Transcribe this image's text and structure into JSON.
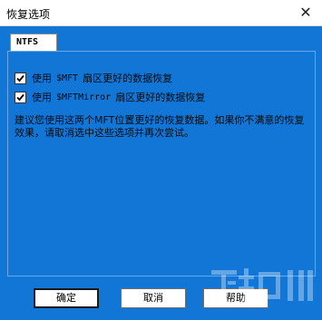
{
  "window": {
    "title": "恢复选项",
    "close_glyph": "✕"
  },
  "tabs": [
    {
      "label": "NTFS"
    }
  ],
  "options": [
    {
      "prefix": "使用",
      "code": "$MFT",
      "suffix": "扇区更好的数据恢复",
      "checked": true
    },
    {
      "prefix": "使用",
      "code": "$MFTMirror",
      "suffix": "扇区更好的数据恢复",
      "checked": true
    }
  ],
  "description": "建议您使用这两个MFT位置更好的恢复数据。如果你不满意的恢复效果，请取消选中这些选项并再次尝试。",
  "buttons": {
    "ok": "确定",
    "cancel": "取消",
    "help": "帮助"
  },
  "icons": {
    "close": "close-icon",
    "check": "checkmark-icon"
  },
  "colors": {
    "background": "#1176d6",
    "titlebar": "#ffffff"
  }
}
